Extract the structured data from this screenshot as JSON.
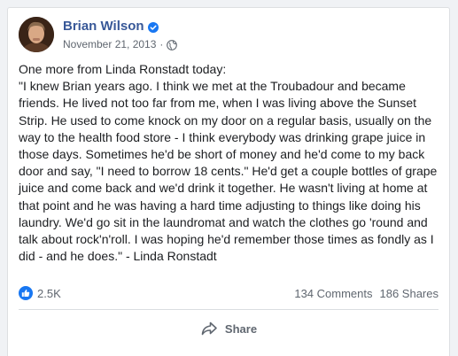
{
  "post": {
    "author": "Brian Wilson",
    "date": "November 21, 2013",
    "separator": "·",
    "text": "One more from Linda Ronstadt today:\n\"I knew Brian years ago. I think we met at the Troubadour and became friends. He lived not too far from me, when I was living above the Sunset Strip. He used to come knock on my door on a regular basis, usually on the way to the health food store - I think everybody was drinking grape juice in those days. Sometimes he'd be short of money and he'd come to my back door and say, \"I need to borrow 18 cents.\" He'd get a couple bottles of grape juice and come back and we'd drink it together. He wasn't living at home at that point and he was having a hard time adjusting to things like doing his laundry. We'd go sit in the laundromat and watch the clothes go 'round and talk about rock'n'roll. I was hoping he'd remember those times as fondly as I did - and he does.\" - Linda Ronstadt"
  },
  "stats": {
    "reactions": "2.5K",
    "comments": "134 Comments",
    "shares": "186 Shares"
  },
  "actions": {
    "share_label": "Share"
  },
  "icons": {
    "verified": "verified-badge-icon",
    "privacy": "globe-icon",
    "reaction": "like-thumb-icon",
    "share": "share-arrow-icon"
  },
  "colors": {
    "author": "#385898",
    "accent": "#1877f2",
    "muted": "#606770",
    "text": "#1c1e21",
    "background": "#f0f2f5"
  }
}
